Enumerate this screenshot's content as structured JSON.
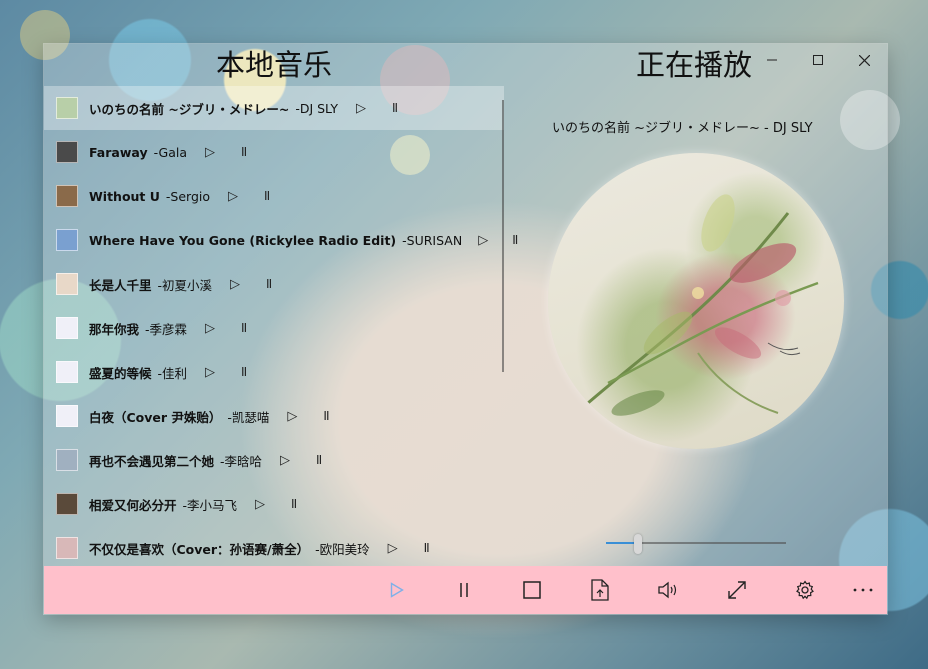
{
  "headings": {
    "local_music": "本地音乐",
    "now_playing": "正在播放"
  },
  "window_controls": {
    "minimize_icon": "minimize-icon",
    "maximize_icon": "maximize-icon",
    "close_icon": "close-icon"
  },
  "tracks": [
    {
      "title": "いのちの名前 ~ジブリ・メドレー~",
      "artist": "-DJ SLY",
      "selected": true,
      "thumb_color": "#b8cfa8"
    },
    {
      "title": "Faraway",
      "artist": "-Gala",
      "thumb_color": "#4a4a4a"
    },
    {
      "title": "Without U",
      "artist": "-Sergio",
      "thumb_color": "#8a6a4a"
    },
    {
      "title": "Where Have You Gone (Rickylee Radio Edit)",
      "artist": "-SURISAN",
      "thumb_color": "#7aa0d0"
    },
    {
      "title": "长是人千里",
      "artist": "-初夏小溪",
      "thumb_color": "#e8d8c8"
    },
    {
      "title": "那年你我",
      "artist": "-季彦霖",
      "thumb_color": "#f0f0f8"
    },
    {
      "title": "盛夏的等候",
      "artist": "-佳利",
      "thumb_color": "#f0f0f8"
    },
    {
      "title": "白夜（Cover 尹姝贻）",
      "artist": "-凯瑟喵",
      "thumb_color": "#f0f0f8"
    },
    {
      "title": "再也不会遇见第二个她",
      "artist": "-李晗哈",
      "thumb_color": "#a0b0c0"
    },
    {
      "title": "相爱又何必分开",
      "artist": "-李小马飞",
      "thumb_color": "#5a4a3a"
    },
    {
      "title": "不仅仅是喜欢（Cover：孙语赛/萧全）",
      "artist": "-欧阳美玲",
      "thumb_color": "#d8b8b8"
    }
  ],
  "track_controls": {
    "play": "▷",
    "pause": "⏸"
  },
  "now_playing": {
    "title": "いのちの名前 ~ジブリ・メドレー~ - DJ SLY",
    "album_art": "album-art-flowers"
  },
  "volume": {
    "level": 0.18
  },
  "bottom_bar": {
    "buttons": [
      {
        "name": "play-button",
        "icon": "play-icon",
        "color": "#7fb0e8"
      },
      {
        "name": "pause-button",
        "icon": "pause-icon"
      },
      {
        "name": "stop-button",
        "icon": "stop-icon"
      },
      {
        "name": "open-file-button",
        "icon": "open-file-icon"
      },
      {
        "name": "volume-button",
        "icon": "volume-icon"
      },
      {
        "name": "fullscreen-button",
        "icon": "fullscreen-icon"
      },
      {
        "name": "settings-button",
        "icon": "gear-icon"
      },
      {
        "name": "more-button",
        "icon": "more-icon"
      }
    ]
  },
  "colors": {
    "bottom_bar": "#ffc0cb",
    "accent": "#3a8fd6"
  }
}
